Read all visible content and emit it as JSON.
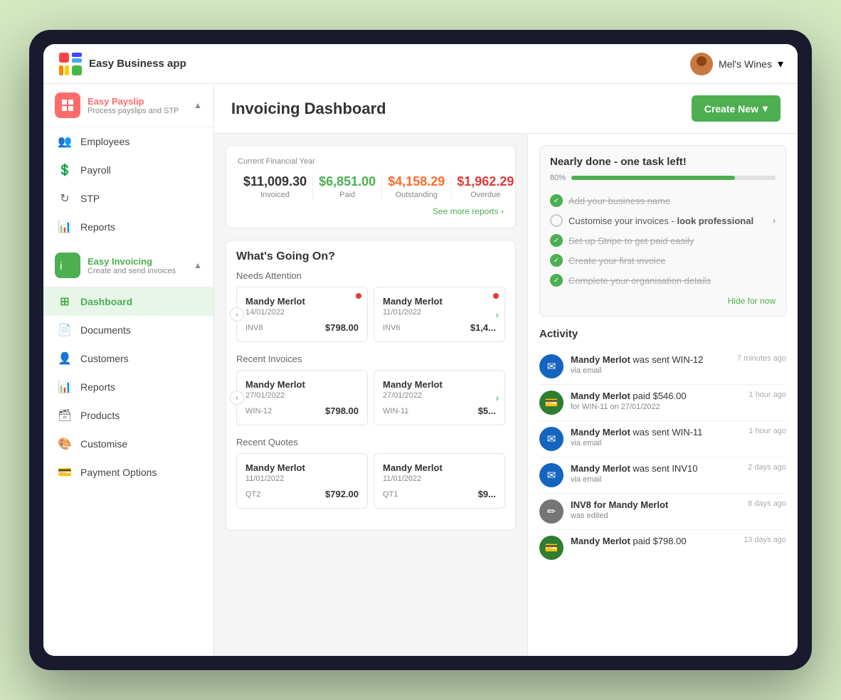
{
  "app": {
    "name": "Easy Business app",
    "user": "Mel's Wines"
  },
  "sidebar": {
    "easy_payslip": {
      "title": "Easy Payslip",
      "subtitle": "Process payslips and STP"
    },
    "payslip_items": [
      {
        "label": "Employees",
        "icon": "👥"
      },
      {
        "label": "Payroll",
        "icon": "💲"
      },
      {
        "label": "STP",
        "icon": "↻"
      },
      {
        "label": "Reports",
        "icon": "📊"
      }
    ],
    "easy_invoicing": {
      "title": "Easy Invoicing",
      "subtitle": "Create and send invoices"
    },
    "invoicing_items": [
      {
        "label": "Dashboard",
        "icon": "⊞",
        "active": true
      },
      {
        "label": "Documents",
        "icon": "📄"
      },
      {
        "label": "Customers",
        "icon": "👤"
      },
      {
        "label": "Reports",
        "icon": "📊"
      },
      {
        "label": "Products",
        "icon": "🗃"
      },
      {
        "label": "Customise",
        "icon": "🎨"
      },
      {
        "label": "Payment Options",
        "icon": "💳"
      }
    ]
  },
  "header": {
    "title": "Invoicing Dashboard",
    "create_btn": "Create New"
  },
  "financial": {
    "label": "Current Financial Year",
    "invoiced_amount": "$11,009.30",
    "invoiced_label": "Invoiced",
    "paid_amount": "$6,851.00",
    "paid_label": "Paid",
    "outstanding_amount": "$4,158.29",
    "outstanding_label": "Outstanding",
    "overdue_amount": "$1,962.29",
    "overdue_label": "Overdue",
    "see_more": "See more reports"
  },
  "whats_going_on": {
    "title": "What's Going On?",
    "needs_attention": {
      "label": "Needs Attention",
      "cards": [
        {
          "customer": "Mandy Merlot",
          "date": "14/01/2022",
          "ref": "INV8",
          "amount": "$798.00"
        },
        {
          "customer": "Mandy Merlot",
          "date": "11/01/2022",
          "ref": "INV6",
          "amount": "$1,4..."
        }
      ]
    },
    "recent_invoices": {
      "label": "Recent Invoices",
      "cards": [
        {
          "customer": "Mandy Merlot",
          "date": "27/01/2022",
          "ref": "WIN-12",
          "amount": "$798.00"
        },
        {
          "customer": "Mandy Merlot",
          "date": "27/01/2022",
          "ref": "WIN-11",
          "amount": "$5..."
        }
      ]
    },
    "recent_quotes": {
      "label": "Recent Quotes",
      "cards": [
        {
          "customer": "Mandy Merlot",
          "date": "11/01/2022",
          "ref": "QT2",
          "amount": "$792.00"
        },
        {
          "customer": "Mandy Merlot",
          "date": "11/01/2022",
          "ref": "QT1",
          "amount": "$9..."
        }
      ]
    }
  },
  "progress": {
    "title": "Nearly done - one task left!",
    "percent": "80%",
    "bar_width": "80",
    "tasks": [
      {
        "label": "Add your business name",
        "done": true
      },
      {
        "label": "Customise your invoices - look professional",
        "done": false,
        "arrow": true
      },
      {
        "label": "Set up Stripe to get paid easily",
        "done": true
      },
      {
        "label": "Create your first invoice",
        "done": true
      },
      {
        "label": "Complete your organisation details",
        "done": true
      }
    ],
    "hide_label": "Hide for now"
  },
  "activity": {
    "title": "Activity",
    "items": [
      {
        "type": "sent",
        "text_bold": "Mandy Merlot",
        "text": " was sent WIN-12",
        "sub": "via email",
        "time": "7 minutes ago",
        "icon": "✉"
      },
      {
        "type": "paid",
        "text_bold": "Mandy Merlot",
        "text": " paid $546.00",
        "sub": "for WIN-11 on 27/01/2022",
        "time": "1 hour ago",
        "icon": "💳"
      },
      {
        "type": "sent",
        "text_bold": "Mandy Merlot",
        "text": " was sent WIN-11",
        "sub": "via email",
        "time": "1 hour ago",
        "icon": "✉"
      },
      {
        "type": "sent",
        "text_bold": "Mandy Merlot",
        "text": " was sent INV10",
        "sub": "via email",
        "time": "2 days ago",
        "icon": "✉"
      },
      {
        "type": "edited",
        "text_bold": "INV8 for Mandy Merlot",
        "text": "",
        "sub": "was edited",
        "time": "8 days ago",
        "icon": "✏"
      },
      {
        "type": "paid",
        "text_bold": "Mandy Merlot",
        "text": " paid $798.00",
        "sub": "",
        "time": "13 days ago",
        "icon": "💳"
      }
    ]
  }
}
